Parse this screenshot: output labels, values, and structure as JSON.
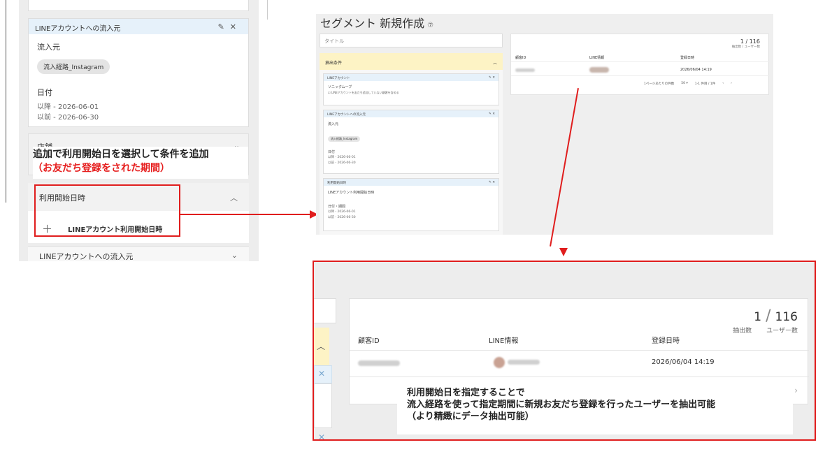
{
  "left_panel": {
    "inflow_card": {
      "header": "LINEアカウントへの流入元",
      "section_label": "流入元",
      "chip": "流入経路_Instagram",
      "date_label": "日付",
      "date_from": "以降 - 2026-06-01",
      "date_to": "以前 - 2026-06-30"
    },
    "shop_label": "店舗",
    "callout_line1": "追加で利用開始日を選択して条件を追加",
    "callout_line2": "（お友だち登録をされた期間）",
    "start_section_title": "利用開始日時",
    "start_add_label": "LINEアカウント利用開始日時",
    "inflow_section_title": "LINEアカウントへの流入元"
  },
  "top_screen": {
    "title": "セグメント 新規作成",
    "title_placeholder": "タイトル",
    "conditions_label": "抽出条件",
    "card1_head": "LINEアカウント",
    "card1_title": "ソニックムーブ",
    "card1_check": "LINEアカウントを友だち追加していない顧客を含める",
    "card2_head": "LINEアカウントへの流入元",
    "card2_section": "流入元",
    "card2_chip": "流入経路_Instagram",
    "card2_date_label": "日付",
    "card2_date_from": "以降 - 2026-06-01",
    "card2_date_to": "以前 - 2026-06-30",
    "card3_head": "利用開始日時",
    "card3_title": "LINEアカウント利用開始日時",
    "card3_date_label": "日付・期間",
    "card3_date_from": "以降 - 2026-06-01",
    "card3_date_to": "以前 - 2026-06-30",
    "count_extracted": "1",
    "count_users": "116",
    "count_extracted_label": "抽出数",
    "count_users_label": "ユーザー数",
    "col_customer_id": "顧客ID",
    "col_line_info": "LINE情報",
    "col_registered": "登録日時",
    "row_registered": "2026/06/04 14:19",
    "per_page_label": "1ページあたりの件数",
    "per_page_value": "50",
    "pager_text": "1-1 件目 / 1件"
  },
  "zoom": {
    "count_extracted": "1",
    "count_users": "116",
    "count_extracted_label": "抽出数",
    "count_users_label": "ユーザー数",
    "col_customer_id": "顧客ID",
    "col_line_info": "LINE情報",
    "col_registered": "登録日時",
    "row_registered": "2026/06/04 14:19",
    "callout_line1": "利用開始日を指定することで",
    "callout_line2": "流入経路を使って指定期間に新規お友だち登録を行ったユーザーを抽出可能",
    "callout_line3": "（より精緻にデータ抽出可能）"
  },
  "colors": {
    "accent_red": "#e01d1d",
    "condition_header_blue": "#e6f1fa",
    "conditions_yellow": "#fdf3c5"
  }
}
